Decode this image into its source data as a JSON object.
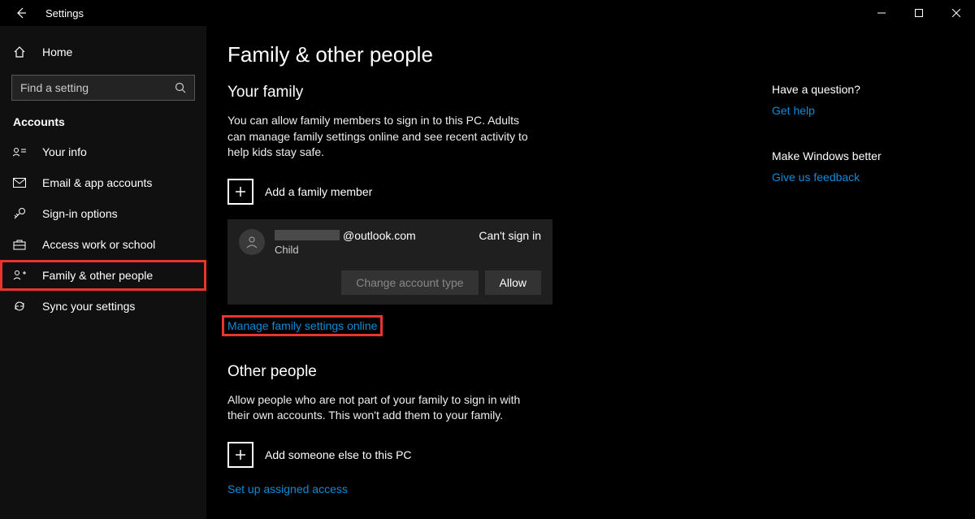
{
  "titlebar": {
    "title": "Settings"
  },
  "sidebar": {
    "home_label": "Home",
    "search_placeholder": "Find a setting",
    "section_label": "Accounts",
    "items": [
      {
        "label": "Your info"
      },
      {
        "label": "Email & app accounts"
      },
      {
        "label": "Sign-in options"
      },
      {
        "label": "Access work or school"
      },
      {
        "label": "Family & other people"
      },
      {
        "label": "Sync your settings"
      }
    ]
  },
  "main": {
    "page_title": "Family & other people",
    "family": {
      "title": "Your family",
      "description": "You can allow family members to sign in to this PC. Adults can manage family settings online and see recent activity to help kids stay safe.",
      "add_label": "Add a family member",
      "member": {
        "email_suffix": "@outlook.com",
        "role": "Child",
        "status": "Can't sign in",
        "change_type_label": "Change account type",
        "allow_label": "Allow"
      },
      "manage_link": "Manage family settings online"
    },
    "other": {
      "title": "Other people",
      "description": "Allow people who are not part of your family to sign in with their own accounts. This won't add them to your family.",
      "add_label": "Add someone else to this PC",
      "assigned_link": "Set up assigned access"
    }
  },
  "aside": {
    "question": {
      "title": "Have a question?",
      "link": "Get help"
    },
    "feedback": {
      "title": "Make Windows better",
      "link": "Give us feedback"
    }
  }
}
